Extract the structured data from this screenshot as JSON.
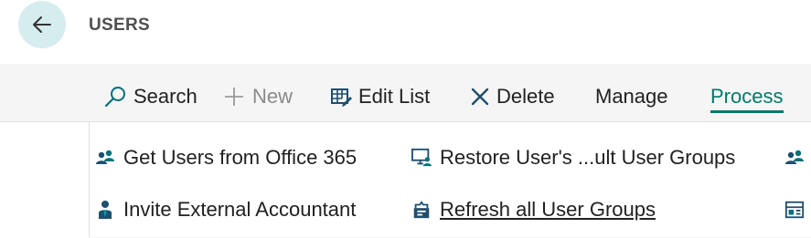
{
  "header": {
    "title": "USERS"
  },
  "actions": {
    "search": "Search",
    "new": "New",
    "edit_list": "Edit List",
    "delete": "Delete",
    "manage": "Manage",
    "process": "Process"
  },
  "process_menu": {
    "items": [
      {
        "label": "Get Users from Office 365",
        "icon": "users-group-icon"
      },
      {
        "label": "Restore User's ...ult User Groups",
        "icon": "monitor-user-icon"
      },
      {
        "label": "Invite External Accountant",
        "icon": "person-tie-icon"
      },
      {
        "label": "Refresh all User Groups",
        "icon": "refresh-users-icon"
      }
    ]
  },
  "colors": {
    "accent": "#00796b",
    "icon_teal": "#00707a",
    "back_button_bg": "#d6edf0",
    "title_gray": "#505050"
  }
}
